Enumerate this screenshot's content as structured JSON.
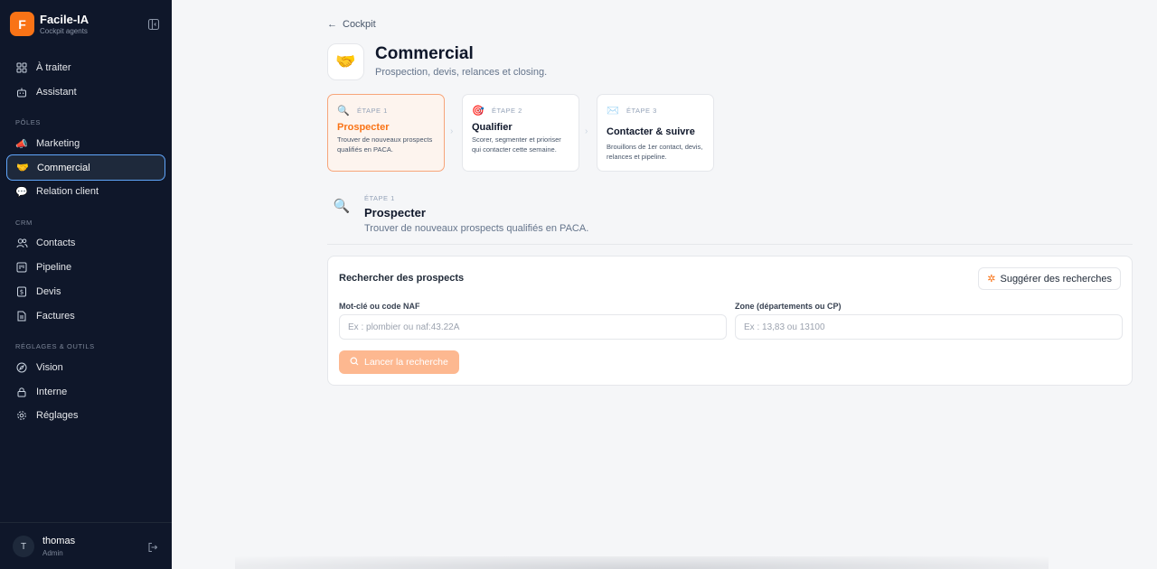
{
  "brand": {
    "initial": "F",
    "name": "Facile-IA",
    "subtitle": "Cockpit agents"
  },
  "nav_top": [
    {
      "label": "À traiter",
      "icon": "grid-icon"
    },
    {
      "label": "Assistant",
      "icon": "robot-icon"
    }
  ],
  "sections": {
    "poles": "PÔLES",
    "crm": "CRM",
    "settings": "RÉGLAGES & OUTILS"
  },
  "nav_poles": [
    {
      "label": "Marketing",
      "icon": "megaphone-icon",
      "glyph": "📣"
    },
    {
      "label": "Commercial",
      "icon": "handshake-icon",
      "glyph": "🤝"
    },
    {
      "label": "Relation client",
      "icon": "speech-bubble-icon",
      "glyph": "💬"
    }
  ],
  "nav_crm": [
    {
      "label": "Contacts",
      "icon": "users-icon"
    },
    {
      "label": "Pipeline",
      "icon": "kanban-icon"
    },
    {
      "label": "Devis",
      "icon": "dollar-doc-icon"
    },
    {
      "label": "Factures",
      "icon": "invoice-icon"
    }
  ],
  "nav_settings": [
    {
      "label": "Vision",
      "icon": "compass-icon"
    },
    {
      "label": "Interne",
      "icon": "lock-icon"
    },
    {
      "label": "Réglages",
      "icon": "gear-icon"
    }
  ],
  "user": {
    "initial": "T",
    "name": "thomas",
    "role": "Admin"
  },
  "header": {
    "back_label": "Cockpit",
    "icon_glyph": "🤝",
    "title": "Commercial",
    "subtitle": "Prospection, devis, relances et closing."
  },
  "steps": [
    {
      "glyph": "🔍",
      "num": "ÉTAPE 1",
      "title": "Prospecter",
      "desc": "Trouver de nouveaux prospects qualifiés en PACA."
    },
    {
      "glyph": "🎯",
      "num": "ÉTAPE 2",
      "title": "Qualifier",
      "desc": "Scorer, segmenter et prioriser qui contacter cette semaine."
    },
    {
      "glyph": "✉️",
      "num": "ÉTAPE 3",
      "title": "Contacter & suivre",
      "desc": "Brouillons de 1er contact, devis, relances et pipeline."
    }
  ],
  "detail": {
    "glyph": "🔍",
    "step": "ÉTAPE 1",
    "title": "Prospecter",
    "subtitle": "Trouver de nouveaux prospects qualifiés en PACA."
  },
  "search_panel": {
    "title": "Rechercher des prospects",
    "suggest_label": "Suggérer des recherches",
    "keyword_label": "Mot-clé ou code NAF",
    "keyword_placeholder": "Ex : plombier ou naf:43.22A",
    "keyword_value": "",
    "zone_label": "Zone (départements ou CP)",
    "zone_placeholder": "Ex : 13,83 ou 13100",
    "zone_value": "",
    "launch_label": "Lancer la recherche"
  },
  "colors": {
    "accent": "#f97316",
    "sidebar_bg": "#0f172a",
    "active_border": "#60a5fa"
  }
}
